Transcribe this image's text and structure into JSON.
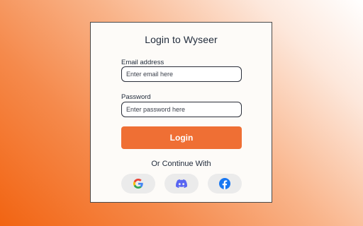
{
  "login": {
    "title": "Login to Wyseer",
    "email_label": "Email address",
    "email_placeholder": "Enter email here",
    "email_value": "",
    "password_label": "Password",
    "password_placeholder": "Enter password here",
    "password_value": "",
    "login_button": "Login",
    "continue_text": "Or Continue With"
  },
  "social": [
    {
      "icon": "google-icon"
    },
    {
      "icon": "discord-icon"
    },
    {
      "icon": "facebook-icon"
    }
  ],
  "colors": {
    "accent": "#ef6f34",
    "card_background": "#fdfbf8",
    "text": "#1f2a3a",
    "social_button_background": "#ebebeb",
    "discord_brand": "#5865f2",
    "facebook_brand": "#1877f2"
  }
}
